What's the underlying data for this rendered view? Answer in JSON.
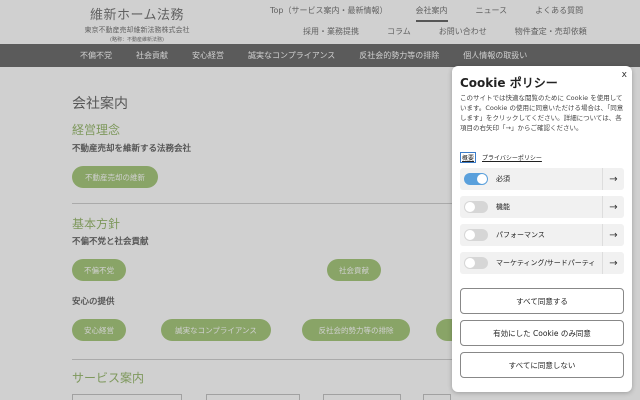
{
  "header": {
    "brand_name": "維新ホーム法務",
    "brand_sub": "東京不動産売却維新法務株式会社",
    "brand_sub2": "(略称：不動産維新法務)",
    "top_links_row1": [
      "Top（サービス案内・最新情報）",
      "会社案内",
      "ニュース",
      "よくある質問"
    ],
    "top_links_row2": [
      "採用・業務提携",
      "コラム",
      "お問い合わせ",
      "物件査定・売却依頼"
    ],
    "active_link": "会社案内"
  },
  "main_nav": [
    "不偏不党",
    "社会貢献",
    "安心経営",
    "誠実なコンプライアンス",
    "反社会的勢力等の排除",
    "個人情報の取扱い"
  ],
  "content": {
    "page_title": "会社案内",
    "section1_heading": "経営理念",
    "section1_sub": "不動産売却を維新する法務会社",
    "section1_pill": "不動産売却の維新",
    "section2_heading": "基本方針",
    "section2_sub": "不偏不党と社会貢献",
    "section2_pills": [
      "不偏不党",
      "社会貢献"
    ],
    "section2_sub2": "安心の提供",
    "section2_pills2": [
      "安心経営",
      "誠実なコンプライアンス",
      "反社会的勢力等の排除"
    ],
    "section3_heading": "サービス案内"
  },
  "cookie": {
    "title": "Cookie ポリシー",
    "close": "x",
    "description": "このサイトでは快適な閲覧のために Cookie を使用しています。Cookie の使用に同意いただける場合は、「同意します」をクリックしてください。詳細については、各項目の右矢印「→」からご確認ください。",
    "link_overview": "概要",
    "link_policy": "プライバシーポリシー",
    "toggles": [
      {
        "label": "必須",
        "on": true
      },
      {
        "label": "機能",
        "on": false
      },
      {
        "label": "パフォーマンス",
        "on": false
      },
      {
        "label": "マーケティング/サードパーティ",
        "on": false
      }
    ],
    "arrow": "→",
    "btn_accept_all": "すべて同意する",
    "btn_accept_selected": "有効にした Cookie のみ同意",
    "btn_reject_all": "すべてに同意しない"
  }
}
